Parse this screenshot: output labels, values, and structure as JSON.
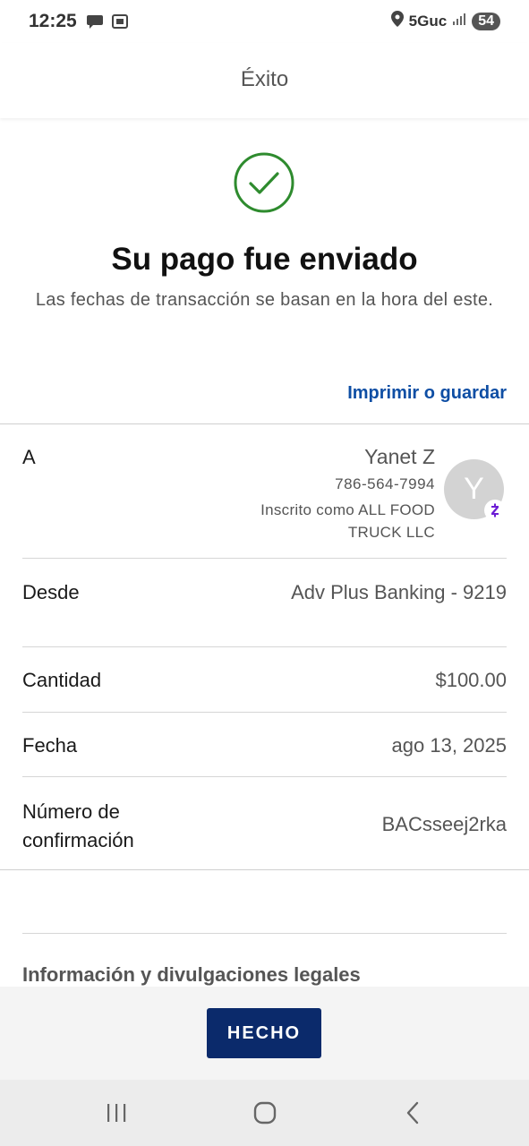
{
  "status_bar": {
    "time": "12:25",
    "network": "5Guc",
    "battery": "54"
  },
  "header": {
    "title": "Éxito"
  },
  "success": {
    "title": "Su pago fue enviado",
    "subtitle": "Las fechas de transacción se basan en la hora del este.",
    "print_link": "Imprimir o guardar",
    "icon": "check-circle-icon",
    "icon_color": "#2e8b2e"
  },
  "details": {
    "to": {
      "label": "A",
      "name": "Yanet Z",
      "phone": "786-564-7994",
      "enrolled": "Inscrito como ALL FOOD TRUCK LLC",
      "avatar_initial": "Y",
      "badge_icon": "zelle-icon",
      "badge_letter": "Z"
    },
    "from": {
      "label": "Desde",
      "value": "Adv Plus Banking - 9219"
    },
    "amount": {
      "label": "Cantidad",
      "value": "$100.00"
    },
    "date": {
      "label": "Fecha",
      "value": "ago 13, 2025"
    },
    "confirmation": {
      "label": "Número de confirmación",
      "value": "BACsseej2rka"
    }
  },
  "legal": {
    "title": "Información y divulgaciones legales"
  },
  "footer": {
    "done_label": "HECHO",
    "accent": "#0b2a6b"
  },
  "nav": {
    "recents": "recents-icon",
    "home": "home-icon",
    "back": "back-icon"
  }
}
